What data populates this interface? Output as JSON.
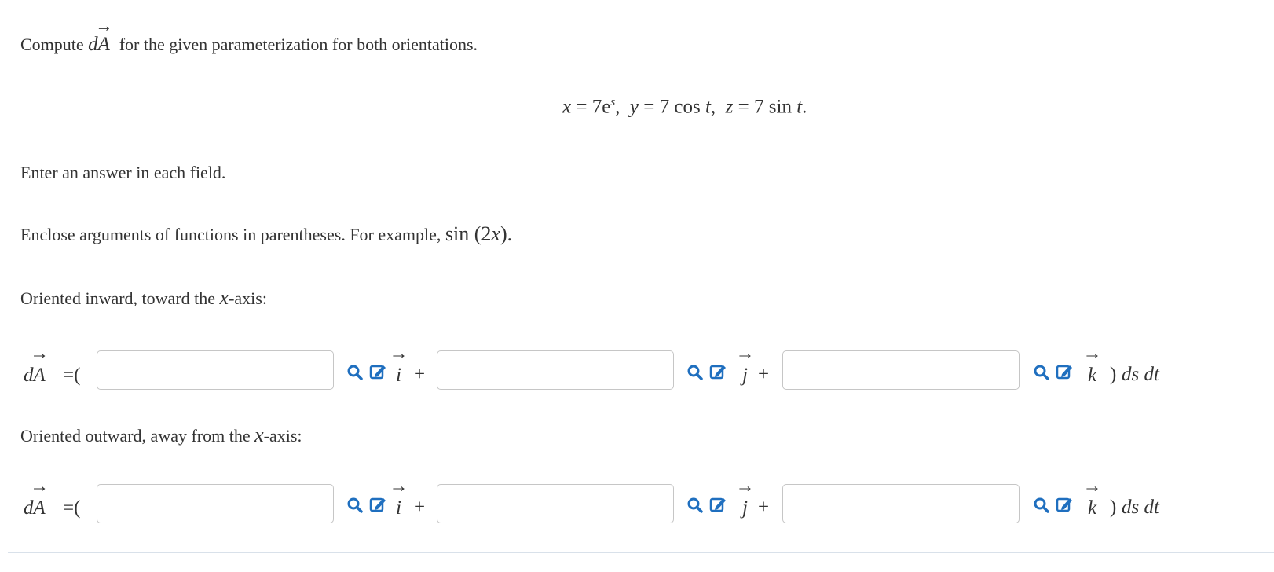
{
  "problem": {
    "prefix": "Compute",
    "dA_d": "d",
    "dA_A": "A",
    "suffix": "for the given parameterization for both orientations.",
    "equation": {
      "x_lhs": "x",
      "x_rhs_coef": "7e",
      "x_rhs_exp": "s",
      "y_lhs": "y",
      "y_rhs": "7 cos",
      "y_var": "t",
      "z_lhs": "z",
      "z_rhs": "7 sin",
      "z_var": "t"
    }
  },
  "instructions": {
    "line1": "Enter an answer in each field.",
    "line2_prefix": "Enclose arguments of functions in parentheses. For example,",
    "line2_example_fn": "sin",
    "line2_example_arg": "(2",
    "line2_example_var": "x",
    "line2_example_close": ")."
  },
  "parts": [
    {
      "label_prefix": "Oriented inward, toward the",
      "label_var": "x",
      "label_suffix": "-axis:",
      "fields": [
        {
          "value": "",
          "unit": "i"
        },
        {
          "value": "",
          "unit": "j"
        },
        {
          "value": "",
          "unit": "k"
        }
      ]
    },
    {
      "label_prefix": "Oriented outward, away from the",
      "label_var": "x",
      "label_suffix": "-axis:",
      "fields": [
        {
          "value": "",
          "unit": "i"
        },
        {
          "value": "",
          "unit": "j"
        },
        {
          "value": "",
          "unit": "k"
        }
      ]
    }
  ],
  "row_text": {
    "lhs_d": "d",
    "lhs_A": "A",
    "equals_paren": "=(",
    "plus": "+",
    "close": ")",
    "ds": "ds",
    "dt": "dt",
    "arrow": "→"
  },
  "colors": {
    "tool_icon": "#1f6fbf",
    "input_border": "#c6c6c6",
    "text": "#333333"
  },
  "icons": {
    "search": "magnifier-icon",
    "edit": "pencil-edit-icon"
  }
}
